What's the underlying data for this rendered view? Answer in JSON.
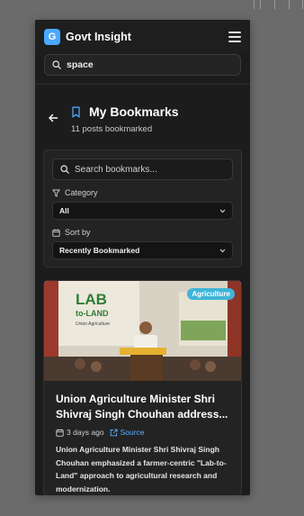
{
  "app": {
    "logo_letter": "G",
    "title": "Govt Insight"
  },
  "top_search": {
    "value": "space"
  },
  "header": {
    "title": "My Bookmarks",
    "subtitle": "11 posts bookmarked"
  },
  "filters": {
    "search_placeholder": "Search bookmarks...",
    "category_label": "Category",
    "category_value": "All",
    "sort_label": "Sort by",
    "sort_value": "Recently Bookmarked"
  },
  "post": {
    "tag": "Agriculture",
    "image_banner_line1": "LAB",
    "image_banner_line2": "to-LAND",
    "image_banner_line3": "Union Agriculture",
    "title": "Union Agriculture Minister Shri Shivraj Singh Chouhan address...",
    "date": "3 days ago",
    "source_label": "Source",
    "excerpt": "Union Agriculture Minister Shri Shivraj Singh Chouhan emphasized a farmer-centric \"Lab-to-Land\" approach to agricultural research and modernization."
  },
  "colors": {
    "accent": "#4aa8ff",
    "link": "#5cb0ff",
    "tag_bg": "#3fb5d8",
    "background": "#1c1c1c"
  }
}
